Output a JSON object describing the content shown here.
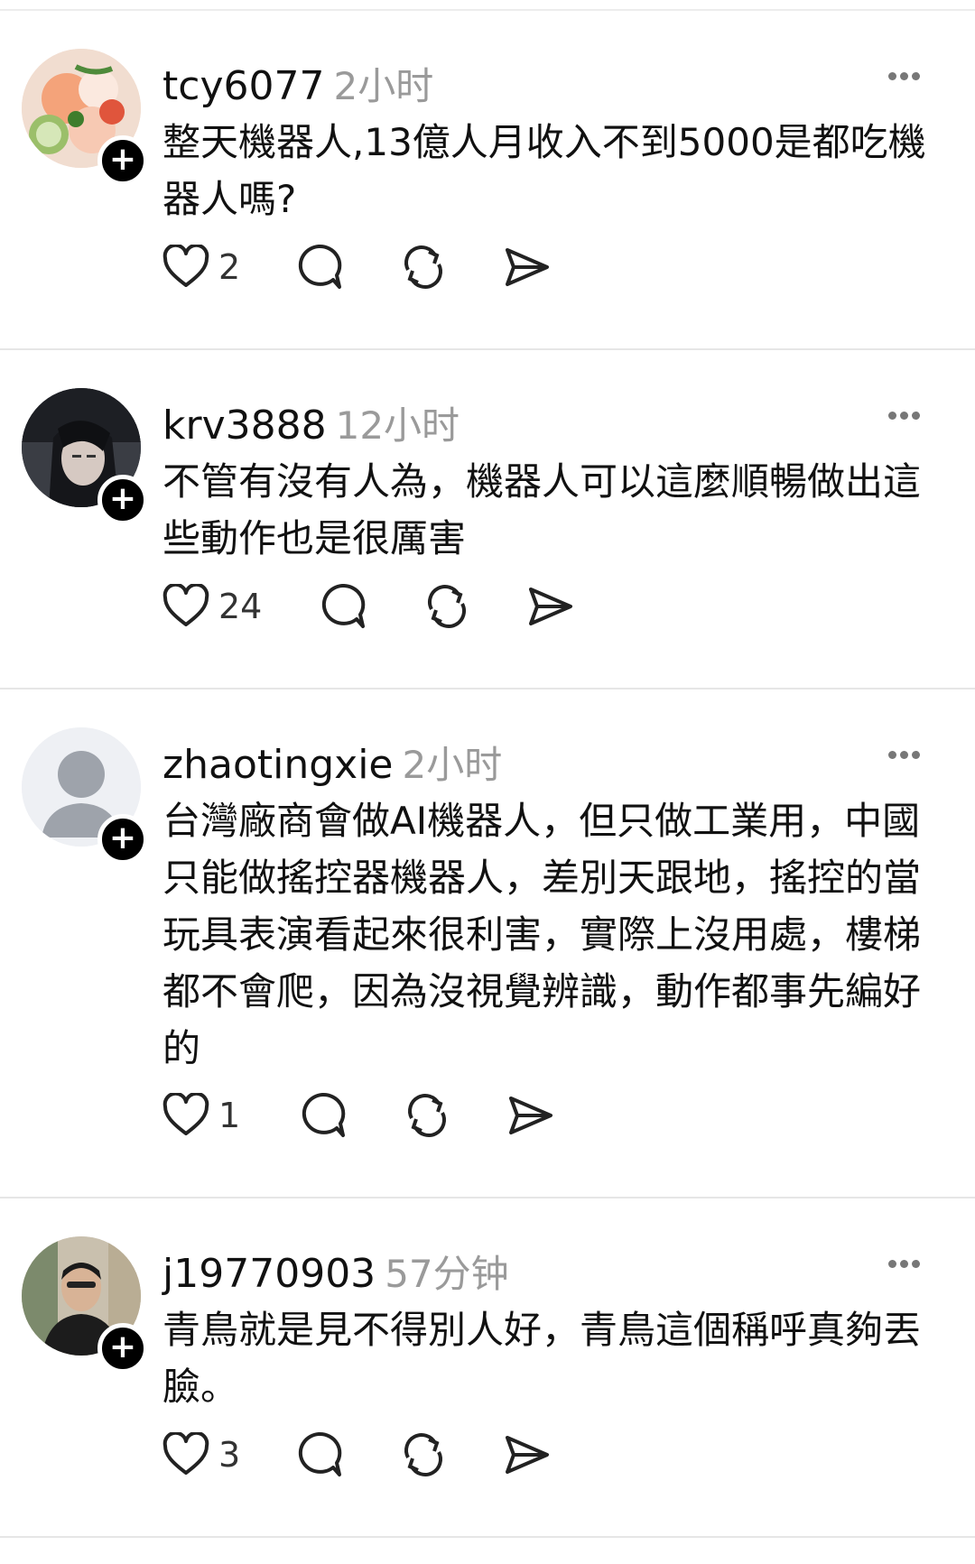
{
  "posts": [
    {
      "username": "tcy6077",
      "time": "2小时",
      "text": "整天機器人,13億人月收入不到5000是都吃機器人嗎?",
      "likes": "2",
      "avatar": "food-photo"
    },
    {
      "username": "krv3888",
      "time": "12小时",
      "text": "不管有沒有人為，機器人可以這麼順暢做出這些動作也是很厲害",
      "likes": "24",
      "avatar": "anime-portrait"
    },
    {
      "username": "zhaotingxie",
      "time": "2小时",
      "text": "台灣廠商會做AI機器人，但只做工業用，中國只能做搖控器機器人，差別天跟地，搖控的當玩具表演看起來很利害，實際上沒用處，樓梯都不會爬，因為沒視覺辨識，動作都事先編好的",
      "likes": "1",
      "avatar": "default-avatar"
    },
    {
      "username": "j19770903",
      "time": "57分钟",
      "text": "青鳥就是見不得別人好，青鳥這個稱呼真夠丟臉。",
      "likes": "3",
      "avatar": "man-photo"
    }
  ],
  "icons": {
    "like": "heart-icon",
    "reply": "comment-icon",
    "repost": "repost-icon",
    "share": "send-icon",
    "more": "more-dots-icon",
    "follow": "plus-icon"
  }
}
